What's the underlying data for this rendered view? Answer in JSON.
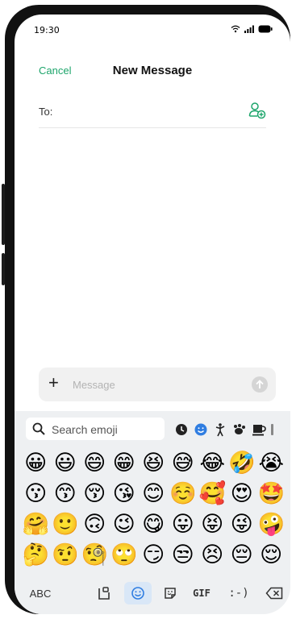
{
  "status_bar": {
    "time": "19:30",
    "icons": [
      "wifi-icon",
      "signal-icon",
      "battery-icon"
    ]
  },
  "header": {
    "cancel_label": "Cancel",
    "title": "New Message"
  },
  "to_field": {
    "label": "To:",
    "icon": "add-contact-icon"
  },
  "compose": {
    "placeholder": "Message",
    "plus_label": "+",
    "send_icon": "send-icon"
  },
  "keyboard": {
    "search_placeholder": "Search emoji",
    "categories": [
      "recent-icon",
      "smileys-icon",
      "people-icon",
      "animals-icon",
      "food-icon"
    ],
    "emoji_rows": [
      [
        "😀",
        "😃",
        "😄",
        "😁",
        "😆",
        "😅",
        "😂",
        "🤣",
        "😭"
      ],
      [
        "😗",
        "😙",
        "😚",
        "😘",
        "😊",
        "☺️",
        "🥰",
        "😍",
        "🤩"
      ],
      [
        "🤗",
        "🙂",
        "🙃",
        "😉",
        "😋",
        "😛",
        "😝",
        "😜",
        "🤪"
      ],
      [
        "🤔",
        "🤨",
        "🧐",
        "🙄",
        "😏",
        "😒",
        "😣",
        "😔",
        "😌"
      ]
    ],
    "bottom": {
      "abc_label": "ABC",
      "gif_label": "GIF",
      "emoticon_label": ":-)"
    }
  },
  "colors": {
    "accent": "#1da56b",
    "keyboard_bg": "#eef0f2",
    "emoji_tab_bg": "#d9e7f7",
    "category_active": "#2f7de1"
  }
}
